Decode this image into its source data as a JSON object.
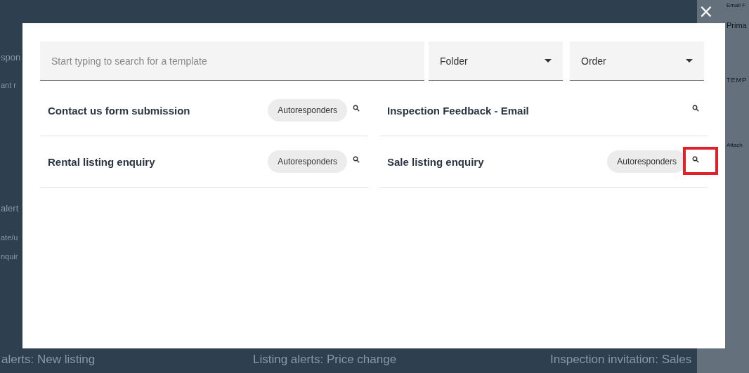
{
  "background": {
    "left_texts": [
      "spon",
      "ant r",
      "alert",
      "ate/u",
      "nquir"
    ],
    "bottom_cards": [
      "alerts: New listing",
      "Listing alerts: Price change",
      "Inspection invitation: Sales"
    ],
    "right_texts": [
      "Email F",
      "Prima",
      "TEMP",
      "Attach"
    ]
  },
  "modal": {
    "close": "×",
    "search": {
      "placeholder": "Start typing to search for a template"
    },
    "filters": [
      {
        "label": "Folder"
      },
      {
        "label": "Order"
      }
    ],
    "templates": [
      {
        "name": "Contact us form submission",
        "tag": "Autoresponders",
        "highlighted": false
      },
      {
        "name": "Inspection Feedback - Email",
        "highlighted": false
      },
      {
        "name": "Rental listing enquiry",
        "tag": "Autoresponders",
        "highlighted": false
      },
      {
        "name": "Sale listing enquiry",
        "tag": "Autoresponders",
        "highlighted": true
      }
    ]
  }
}
